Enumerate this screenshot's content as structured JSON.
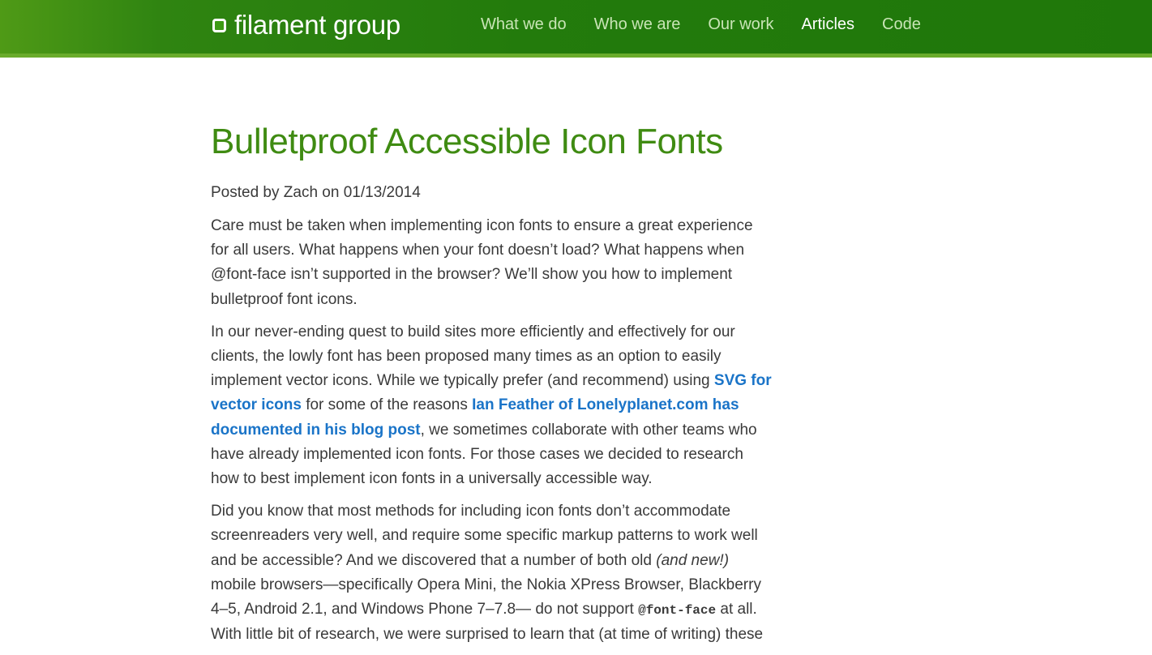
{
  "header": {
    "logo_text": "filament group",
    "nav": [
      {
        "label": "What we do"
      },
      {
        "label": "Who we are"
      },
      {
        "label": "Our work"
      },
      {
        "label": "Articles",
        "active": true
      },
      {
        "label": "Code"
      }
    ]
  },
  "article": {
    "title": "Bulletproof Accessible Icon Fonts",
    "byline": "Posted by Zach on 01/13/2014",
    "p1": "Care must be taken when implementing icon fonts to ensure a great experience for all users. What happens when your font doesn’t load? What happens when @font-face isn’t supported in the browser? We’ll show you how to implement bulletproof font icons.",
    "p2": {
      "t1": "In our never-ending quest to build sites more efficiently and effectively for our clients, the lowly font has been proposed many times as an option to easily implement vector icons. While we typically prefer (and recommend) using ",
      "link1": "SVG for vector icons",
      "t2": " for some of the reasons ",
      "link2": "Ian Feather of Lonelyplanet.com has documented in his blog post",
      "t3": ", we sometimes collaborate with other teams who have already implemented icon fonts. For those cases we decided to research how to best implement icon fonts in a universally accessible way."
    },
    "p3": {
      "t1": "Did you know that most methods for including icon fonts don’t accommodate screenreaders very well, and require some specific markup patterns to work well and be accessible? And we discovered that a number of both old ",
      "em": "(and new!)",
      "t2": " mobile browsers—specifically Opera Mini, the Nokia XPress Browser, Blackberry 4–5, Android 2.1, and Windows Phone 7–7.8— do not support ",
      "code": "@font-face",
      "t3": " at all. With little bit of research, we were surprised to learn that (at time of writing) these"
    }
  },
  "colors": {
    "header_green": "#237b0c",
    "title_green": "#3f8b12",
    "link_blue": "#1a74c8"
  }
}
